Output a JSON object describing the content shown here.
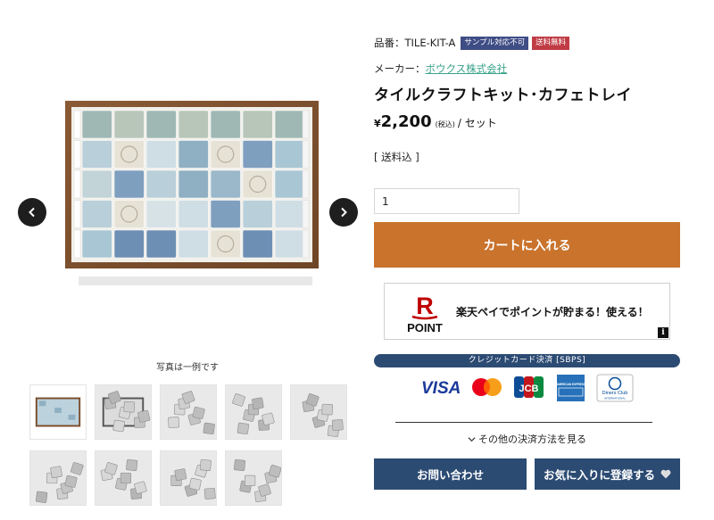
{
  "product": {
    "sku_label": "品番：",
    "sku": "TILE-KIT-A",
    "badges": {
      "sample": "サンプル対応不可",
      "shipping": "送料無料"
    },
    "maker_label": "メーカー：",
    "maker": "ボウクス株式会社",
    "title": "タイルクラフトキット･カフェトレイ",
    "price": {
      "currency": "¥",
      "amount": "2,200",
      "tax": "(税込)",
      "unit": "/ セット"
    },
    "shipping_note": "[ 送料込 ]",
    "quantity": "1",
    "add_to_cart": "カートに入れる"
  },
  "gallery": {
    "caption": "写真は一例です",
    "thumbnail_count": 9
  },
  "rakuten": {
    "logo_letter": "R",
    "logo_word": "POINT",
    "text": "楽天ペイでポイントが貯まる！使える！",
    "info_icon": "i"
  },
  "payment": {
    "sbps_label": "クレジットカード決済 [SBPS]",
    "card_visa": "VISA",
    "card_jcb": "JCB",
    "card_amex": "AMERICAN EXPRESS",
    "card_diners_line1": "Diners Club",
    "card_diners_line2": "INTERNATIONAL",
    "other_methods": "その他の決済方法を見る"
  },
  "actions": {
    "inquiry": "お問い合わせ",
    "favorite": "お気に入りに登録する"
  },
  "colors": {
    "cart": "#c9732c",
    "navy": "#2c4b73",
    "sample_badge": "#3f4d85",
    "shipping_badge": "#c03b44",
    "maker_link": "#3aa38a",
    "rakuten_red": "#bf0000"
  },
  "icons": {
    "prev": "chevron-left-icon",
    "next": "chevron-right-icon",
    "other_methods": "chevron-down-icon",
    "favorite": "heart-icon",
    "info": "info-icon"
  }
}
